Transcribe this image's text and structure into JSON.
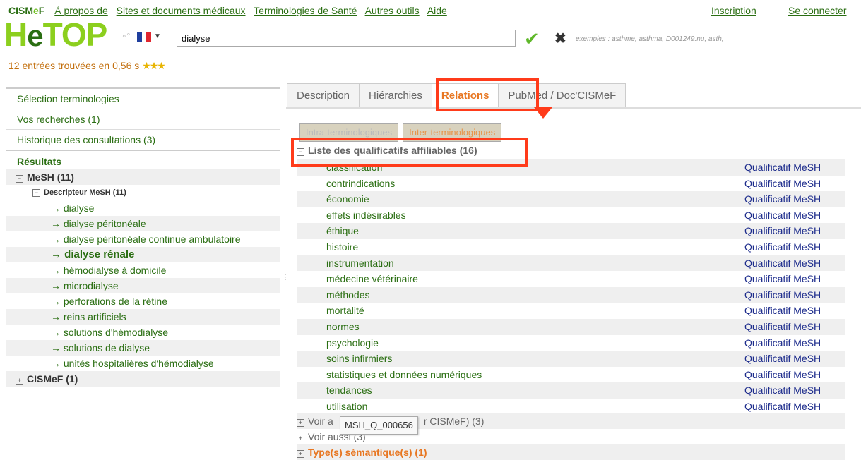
{
  "topnav": {
    "brand_prefix": "CISM",
    "brand_e": "e",
    "brand_suffix": "F",
    "links": [
      "À propos de",
      "Sites et documents médicaux",
      "Terminologies de Santé",
      "Autres outils",
      "Aide"
    ],
    "inscription": "Inscription",
    "login": "Se connecter"
  },
  "logo": {
    "h": "H",
    "e": "e",
    "rest": "TOP"
  },
  "search": {
    "value": "dialyse",
    "examples": "exemples : asthme, asthma, D001249.nu, asth,"
  },
  "results_info": {
    "count_text": "12 entrées trouvées",
    "time_text": "en 0,56 s",
    "stars": "★★★"
  },
  "sidebar": {
    "selection": "Sélection terminologies",
    "searches": "Vos recherches (1)",
    "history": "Historique des consultations (3)",
    "results_heading": "Résultats",
    "mesh_label": "MeSH (11)",
    "descriptor_label": "Descripteur MeSH (11)",
    "leaves": [
      "dialyse",
      "dialyse péritonéale",
      "dialyse péritonéale continue ambulatoire",
      "dialyse rénale",
      "hémodialyse à domicile",
      "microdialyse",
      "perforations de la rétine",
      "reins artificiels",
      "solutions d'hémodialyse",
      "solutions de dialyse",
      "unités hospitalières d'hémodialyse"
    ],
    "cismef_label": "CISMeF (1)"
  },
  "tabs": [
    "Description",
    "Hiérarchies",
    "Relations",
    "PubMed / Doc'CISMeF"
  ],
  "subbuttons": [
    "Intra-terminologiques",
    "Inter-terminologiques"
  ],
  "list": {
    "heading": "Liste des qualificatifs affiliables (16)",
    "type_label": "Qualificatif MeSH",
    "items": [
      "classification",
      "contrindications",
      "économie",
      "effets indésirables",
      "éthique",
      "histoire",
      "instrumentation",
      "médecine vétérinaire",
      "méthodes",
      "mortalité",
      "normes",
      "psychologie",
      "soins infirmiers",
      "statistiques et données numériques",
      "tendances",
      "utilisation"
    ]
  },
  "more": {
    "voir_prefix": "Voir a",
    "voir_suffix": "r CISMeF) (3)",
    "voir_aussi": "Voir aussi (3)",
    "semantic": "Type(s) sémantique(s) (1)"
  },
  "tooltip": "MSH_Q_000656",
  "colors": {
    "brand_green": "#2a6e12",
    "logo_green": "#8ccf1e",
    "accent_orange": "#e87722",
    "annotation_red": "#ff3b1a",
    "qualifier_blue": "#1d2c8c"
  }
}
